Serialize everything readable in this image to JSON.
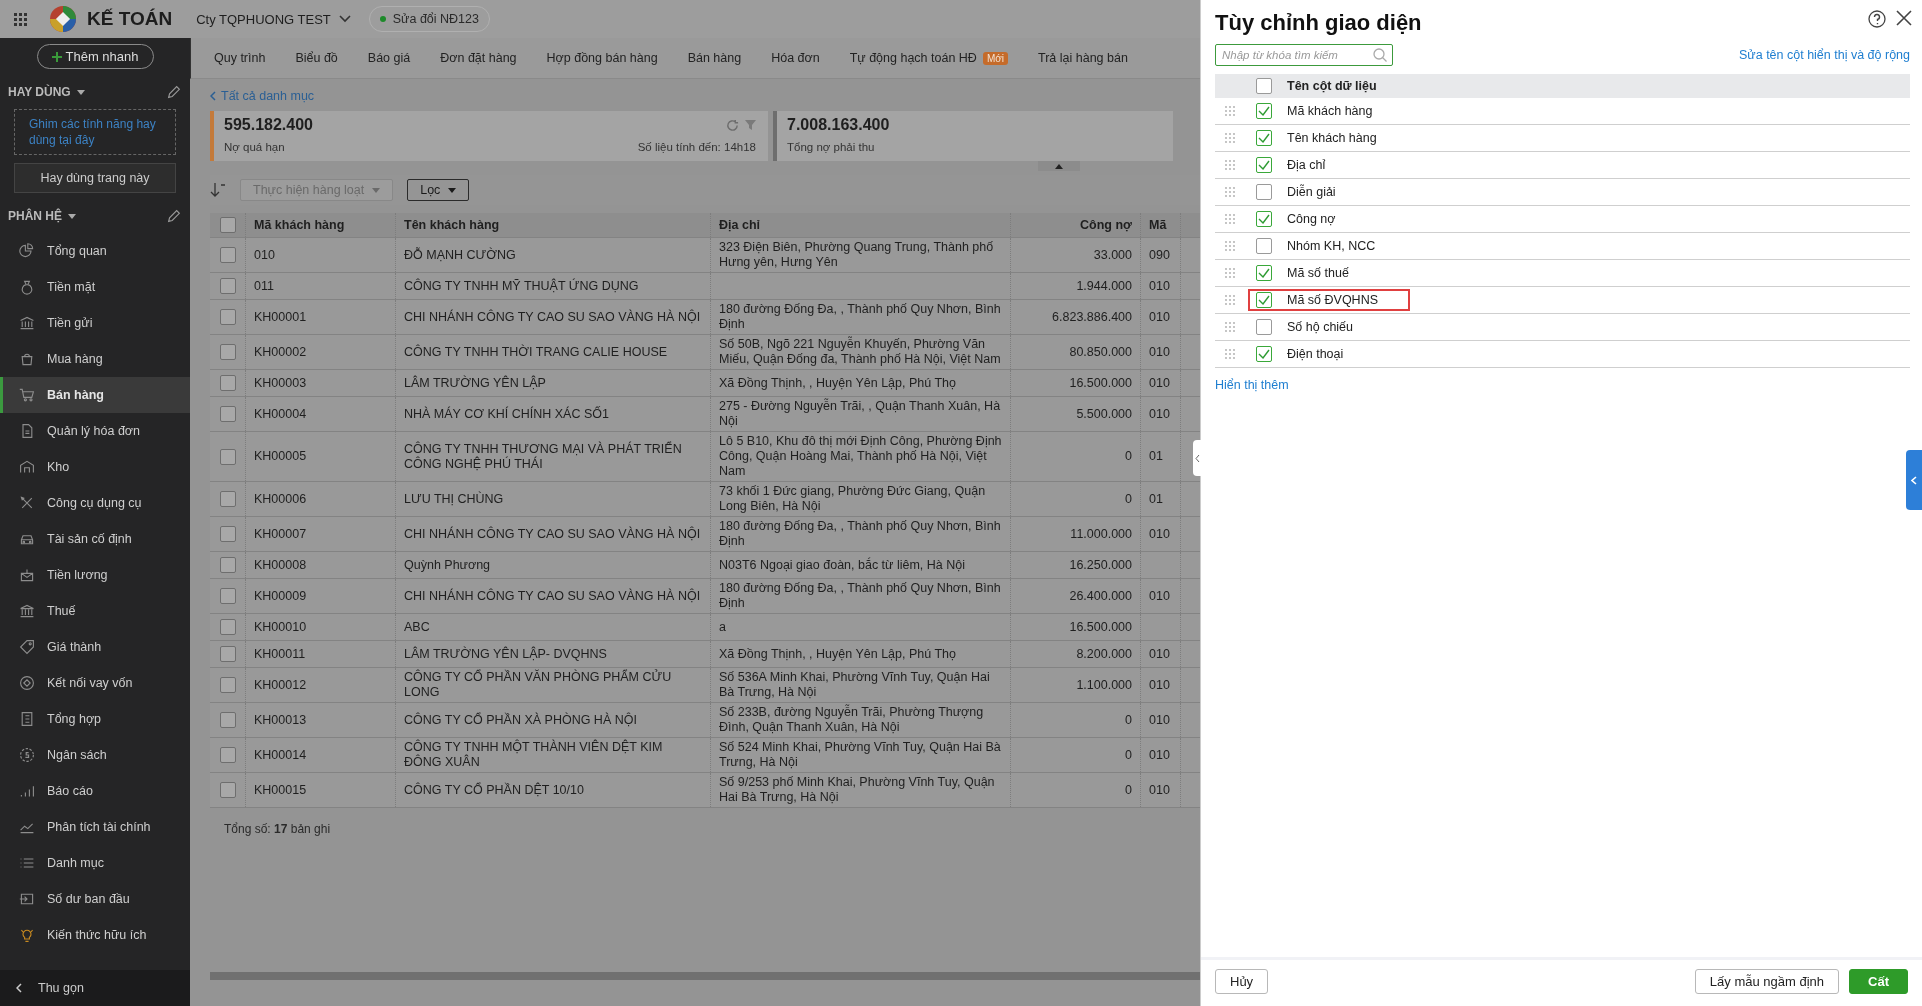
{
  "topbar": {
    "app_name": "KẾ TOÁN",
    "company": "Cty TQPHUONG TEST",
    "version_badge": "Sửa đổi NĐ123"
  },
  "sidebar": {
    "quick_add": "Thêm nhanh",
    "favorites_title": "HAY DÙNG",
    "favorites_hint": "Ghim các tính năng hay dùng tại đây",
    "favorites_button": "Hay dùng trang này",
    "modules_title": "PHÂN HỆ",
    "collapse": "Thu gọn",
    "items": [
      {
        "label": "Tổng quan",
        "selected": false
      },
      {
        "label": "Tiền mặt",
        "selected": false
      },
      {
        "label": "Tiền gửi",
        "selected": false
      },
      {
        "label": "Mua hàng",
        "selected": false
      },
      {
        "label": "Bán hàng",
        "selected": true
      },
      {
        "label": "Quản lý hóa đơn",
        "selected": false
      },
      {
        "label": "Kho",
        "selected": false
      },
      {
        "label": "Công cụ dụng cụ",
        "selected": false
      },
      {
        "label": "Tài sản cố định",
        "selected": false
      },
      {
        "label": "Tiền lương",
        "selected": false
      },
      {
        "label": "Thuế",
        "selected": false
      },
      {
        "label": "Giá thành",
        "selected": false
      },
      {
        "label": "Kết nối vay vốn",
        "selected": false
      },
      {
        "label": "Tổng hợp",
        "selected": false
      },
      {
        "label": "Ngân sách",
        "selected": false
      },
      {
        "label": "Báo cáo",
        "selected": false
      },
      {
        "label": "Phân tích tài chính",
        "selected": false
      },
      {
        "label": "Danh mục",
        "selected": false
      },
      {
        "label": "Số dư ban đầu",
        "selected": false
      },
      {
        "label": "Kiến thức hữu ích",
        "selected": false
      }
    ]
  },
  "tabs": [
    {
      "label": "Quy trình"
    },
    {
      "label": "Biểu đồ"
    },
    {
      "label": "Báo giá"
    },
    {
      "label": "Đơn đặt hàng"
    },
    {
      "label": "Hợp đồng bán hàng"
    },
    {
      "label": "Bán hàng"
    },
    {
      "label": "Hóa đơn"
    },
    {
      "label": "Tự động hạch toán HĐ",
      "badge": "Mới"
    },
    {
      "label": "Trả lại hàng bán"
    }
  ],
  "breadcrumb": "Tất cả danh mục",
  "summary": [
    {
      "value": "595.182.400",
      "label": "Nợ quá hạn",
      "note": "Số liệu tính đến: 14h18",
      "color": "#c47a3a"
    },
    {
      "value": "7.008.163.400",
      "label": "Tổng nợ phải thu",
      "color": "#6e6e6e"
    }
  ],
  "toolbar": {
    "batch": "Thực hiện hàng loạt",
    "filter": "Lọc"
  },
  "table": {
    "header_checked": false,
    "columns": [
      "Mã khách hàng",
      "Tên khách hàng",
      "Địa chỉ",
      "Công nợ",
      "Mã"
    ],
    "rows": [
      {
        "checked": false,
        "cells": [
          "010",
          "ĐỖ MẠNH CƯỜNG",
          "323 Điện Biên, Phường Quang Trung, Thành phố Hưng yên, Hưng Yên",
          "33.000",
          "090"
        ]
      },
      {
        "checked": false,
        "cells": [
          "011",
          "CÔNG TY TNHH MỸ THUẬT ỨNG DỤNG",
          "",
          "1.944.000",
          "010"
        ]
      },
      {
        "checked": false,
        "cells": [
          "KH00001",
          "CHI NHÁNH CÔNG TY CAO SU SAO VÀNG HÀ NỘI",
          "180 đường Đống Đa, , Thành phố Quy Nhơn, Bình Định",
          "6.823.886.400",
          "010"
        ]
      },
      {
        "checked": false,
        "cells": [
          "KH00002",
          "CÔNG TY TNHH THỜI TRANG CALIE HOUSE",
          "Số 50B, Ngõ 221 Nguyễn Khuyến, Phường Văn Miếu, Quận Đống đa, Thành phố Hà Nội, Việt Nam",
          "80.850.000",
          "010"
        ]
      },
      {
        "checked": false,
        "cells": [
          "KH00003",
          "LÂM TRƯỜNG YÊN LẬP",
          "Xã Đồng Thịnh, , Huyện Yên Lập, Phú Thọ",
          "16.500.000",
          "010"
        ]
      },
      {
        "checked": false,
        "cells": [
          "KH00004",
          "NHÀ MÁY CƠ KHÍ CHÍNH XÁC SỐ1",
          "275 - Đường Nguyễn Trãi, , Quận Thanh Xuân, Hà Nội",
          "5.500.000",
          "010"
        ]
      },
      {
        "checked": false,
        "cells": [
          "KH00005",
          "CÔNG TY TNHH THƯƠNG MẠI  VÀ PHÁT TRIỂN CÔNG NGHỆ PHÚ THÁI",
          "Lô 5 B10, Khu đô thị mới Định Công, Phường Định Công, Quận Hoàng Mai, Thành phố Hà Nội, Việt Nam",
          "0",
          "01"
        ]
      },
      {
        "checked": false,
        "cells": [
          "KH00006",
          "LƯU THỊ CHÙNG",
          "73 khối 1 Đức giang, Phường Đức Giang, Quận Long Biên, Hà Nội",
          "0",
          "01"
        ]
      },
      {
        "checked": false,
        "cells": [
          "KH00007",
          "CHI NHÁNH CÔNG TY CAO SU SAO VÀNG HÀ NỘI",
          "180 đường Đống Đa, , Thành phố Quy Nhơn, Bình Định",
          "11.000.000",
          "010"
        ]
      },
      {
        "checked": false,
        "cells": [
          "KH00008",
          "Quỳnh Phương",
          "N03T6 Ngoại giao đoàn, bắc từ liêm, Hà Nội",
          "16.250.000",
          ""
        ]
      },
      {
        "checked": false,
        "cells": [
          "KH00009",
          "CHI NHÁNH CÔNG TY CAO SU SAO VÀNG HÀ NỘI",
          "180 đường Đống Đa, , Thành phố Quy Nhơn, Bình Định",
          "26.400.000",
          "010"
        ]
      },
      {
        "checked": false,
        "cells": [
          "KH00010",
          "ABC",
          "a",
          "16.500.000",
          ""
        ]
      },
      {
        "checked": false,
        "cells": [
          "KH00011",
          "LÂM TRƯỜNG YÊN LẬP- DVQHNS",
          "Xã Đồng Thịnh, , Huyện Yên Lập, Phú Thọ",
          "8.200.000",
          "010"
        ]
      },
      {
        "checked": false,
        "cells": [
          "KH00012",
          "CÔNG TY CỔ PHẦN VĂN PHÒNG PHẨM CỬU LONG",
          "Số 536A Minh Khai, Phường Vĩnh Tuy, Quận Hai Bà Trưng, Hà Nội",
          "1.100.000",
          "010"
        ]
      },
      {
        "checked": false,
        "cells": [
          "KH00013",
          "CÔNG TY CỔ PHẦN XÀ PHÒNG HÀ NỘI",
          "Số 233B, đường Nguyễn Trãi, Phường Thượng Đình, Quận Thanh Xuân, Hà Nội",
          "0",
          "010"
        ]
      },
      {
        "checked": false,
        "cells": [
          "KH00014",
          "CÔNG TY TNHH MỘT THÀNH VIÊN DỆT KIM ĐÔNG XUÂN",
          "Số 524 Minh Khai, Phường Vĩnh Tuy, Quận Hai Bà Trưng, Hà Nội",
          "0",
          "010"
        ]
      },
      {
        "checked": false,
        "cells": [
          "KH00015",
          "CÔNG TY CỔ PHẦN DỆT 10/10",
          "Số 9/253 phố Minh Khai, Phường Vĩnh Tuy, Quận Hai Bà Trưng, Hà Nội",
          "0",
          "010"
        ]
      }
    ]
  },
  "total": "Tổng số: **17** bản ghi",
  "panel": {
    "title": "Tùy chỉnh giao diện",
    "search_placeholder": "Nhập từ khóa tìm kiếm",
    "rename_link": "Sửa tên cột hiển thị và độ rộng",
    "header_checked": false,
    "header": "Tên cột dữ liệu",
    "items": [
      {
        "label": "Mã khách hàng",
        "checked": true,
        "highlighted": false
      },
      {
        "label": "Tên khách hàng",
        "checked": true,
        "highlighted": false
      },
      {
        "label": "Địa chỉ",
        "checked": true,
        "highlighted": false
      },
      {
        "label": "Diễn giải",
        "checked": false,
        "highlighted": false
      },
      {
        "label": "Công nợ",
        "checked": true,
        "highlighted": false
      },
      {
        "label": "Nhóm KH, NCC",
        "checked": false,
        "highlighted": false
      },
      {
        "label": "Mã số thuế",
        "checked": true,
        "highlighted": false
      },
      {
        "label": "Mã số ĐVQHNS",
        "checked": true,
        "highlighted": true
      },
      {
        "label": "Số hộ chiếu",
        "checked": false,
        "highlighted": false
      },
      {
        "label": "Điện thoại",
        "checked": true,
        "highlighted": false
      }
    ],
    "show_more": "Hiển thị thêm",
    "cancel": "Hủy",
    "default_button": "Lấy mẫu ngầm định",
    "save": "Cất"
  }
}
